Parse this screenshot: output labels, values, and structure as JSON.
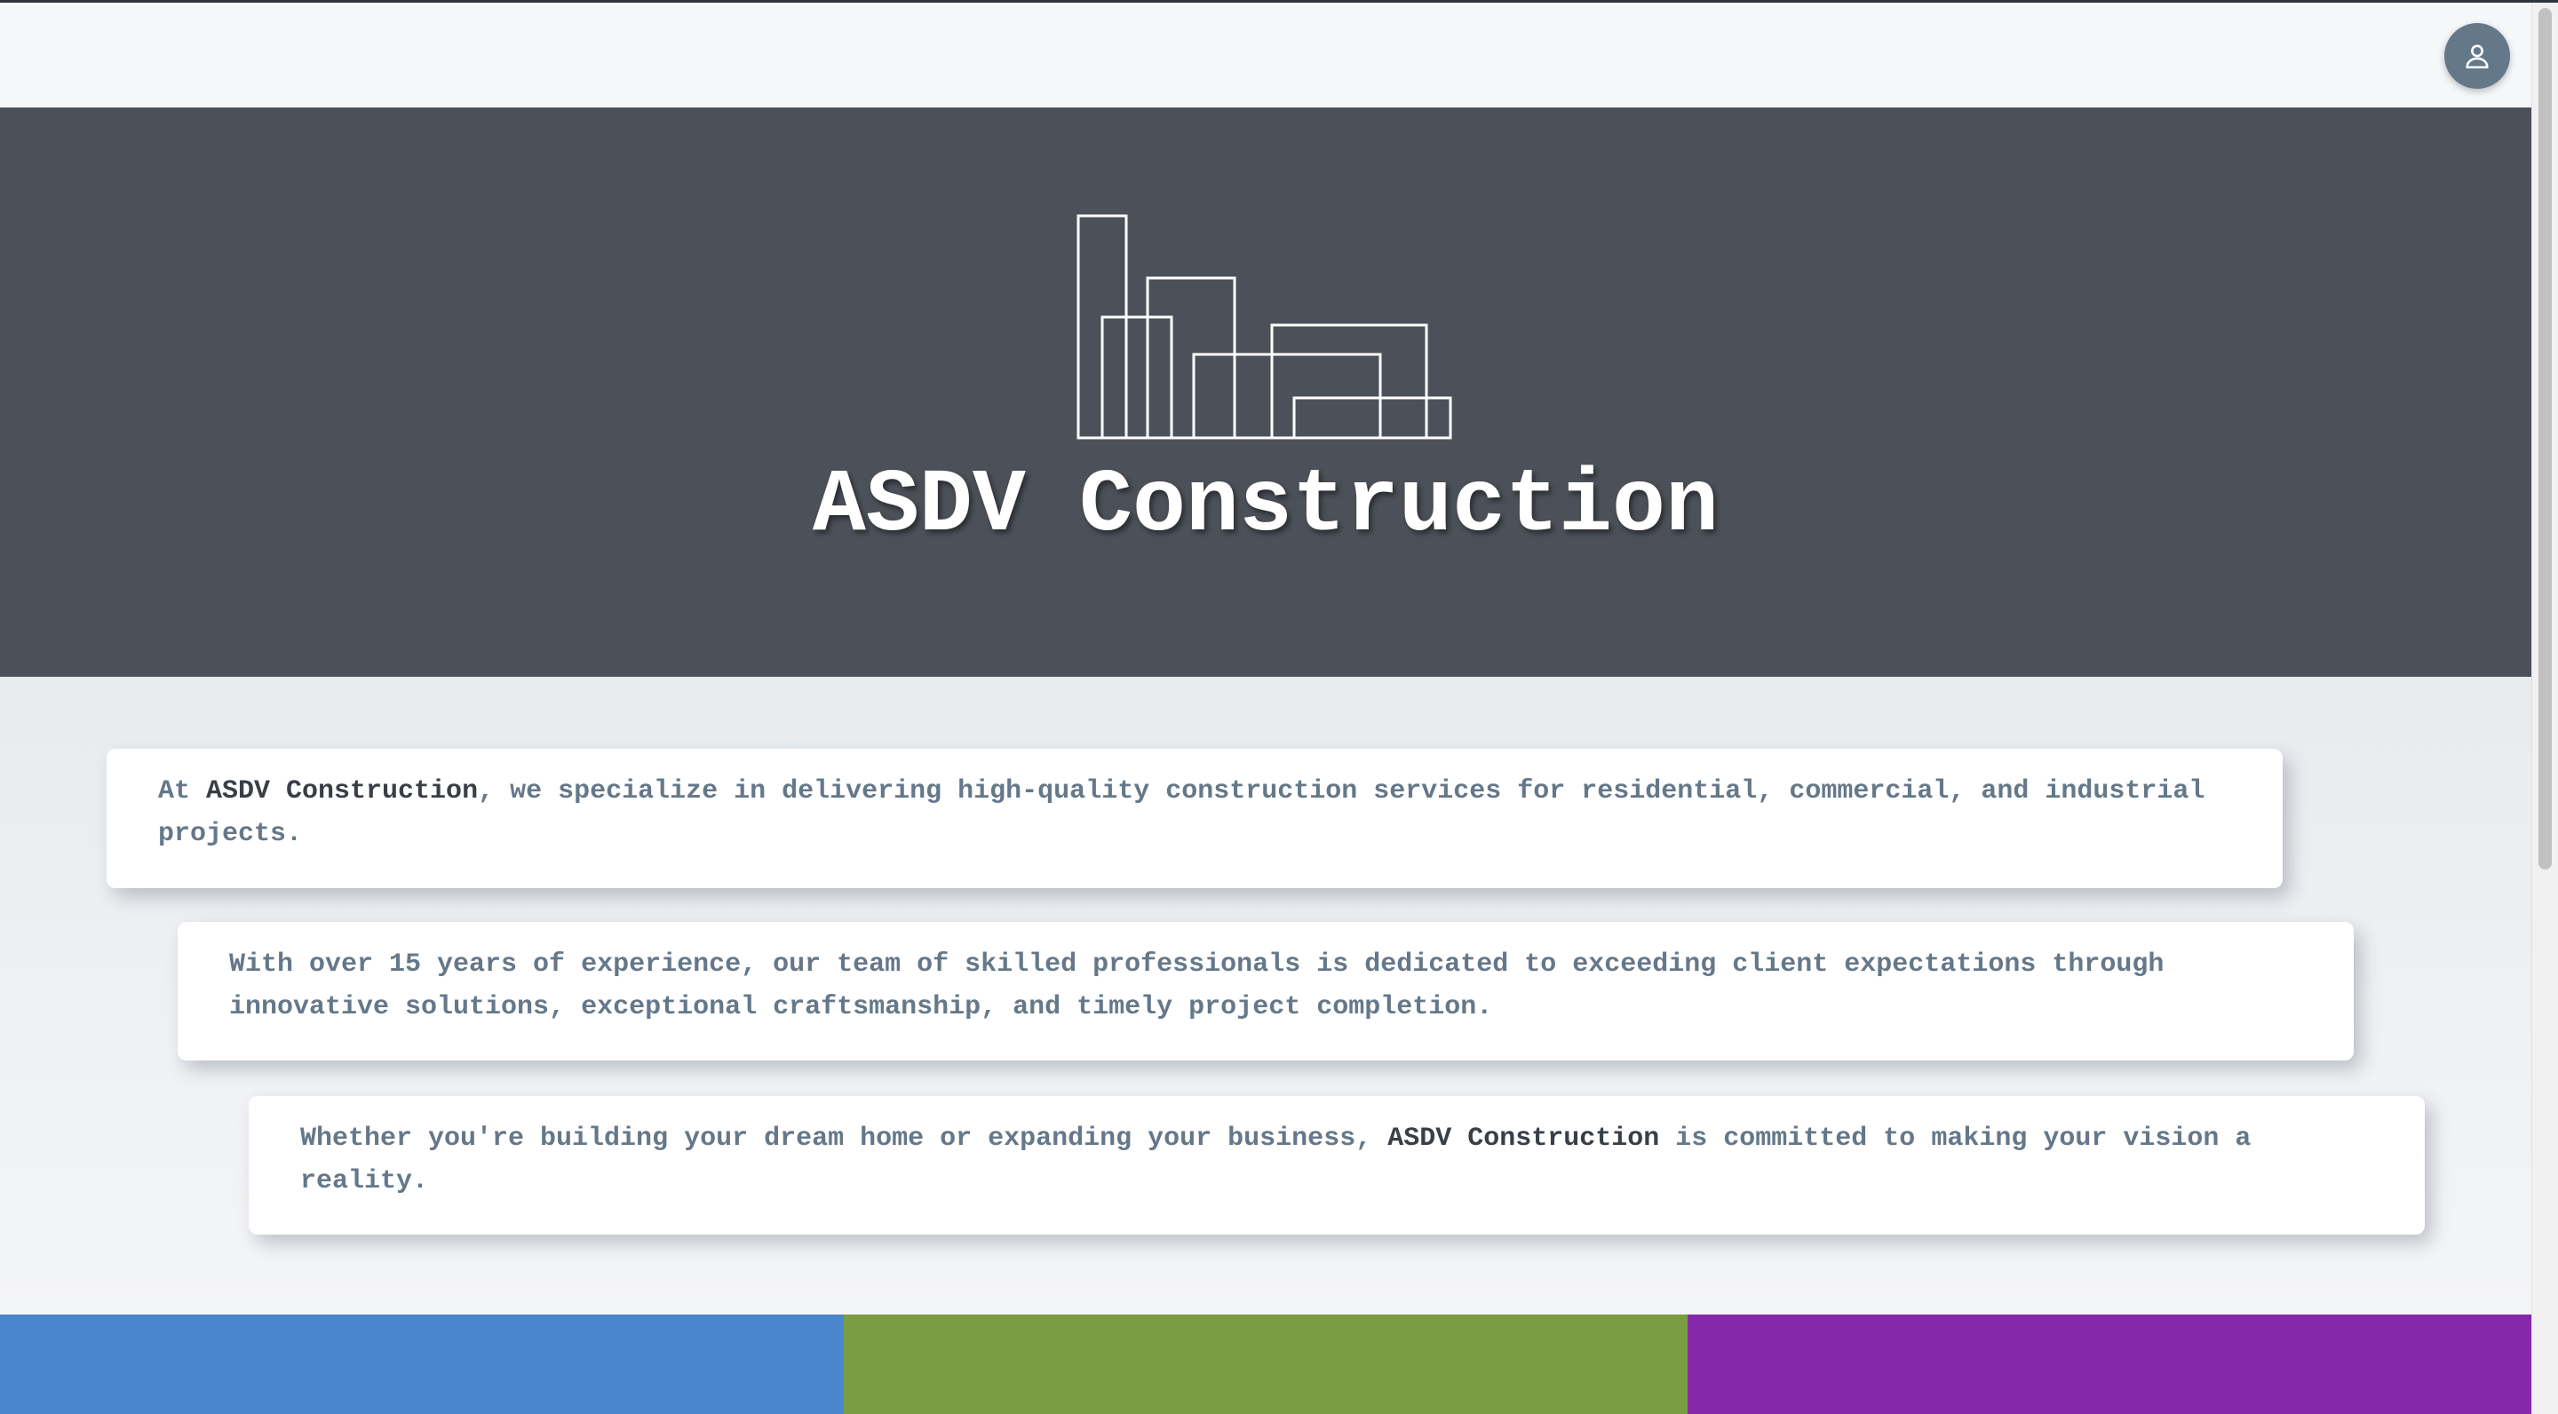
{
  "header": {
    "user_icon": "user-icon"
  },
  "hero": {
    "logo_icon": "buildings-outline-icon",
    "title": "ASDV Construction"
  },
  "cards": [
    {
      "pre": "At ",
      "brand": "ASDV Construction",
      "post": ", we specialize in delivering high-quality construction services for residential, commercial, and industrial projects."
    },
    {
      "pre": "With over 15 years of experience, our team of skilled professionals is dedicated to exceeding client expectations through innovative solutions, exceptional craftsmanship, and timely project completion.",
      "brand": "",
      "post": ""
    },
    {
      "pre": "Whether you're building your dream home or expanding your business, ",
      "brand": "ASDV Construction",
      "post": " is committed to making your vision a reality."
    }
  ],
  "colors": {
    "hero_bg": "#4c5058",
    "text_muted": "#65788a",
    "brand_text": "#3a3f45",
    "strip": [
      "#4a86cc",
      "#7a9c42",
      "#8529ab"
    ]
  }
}
